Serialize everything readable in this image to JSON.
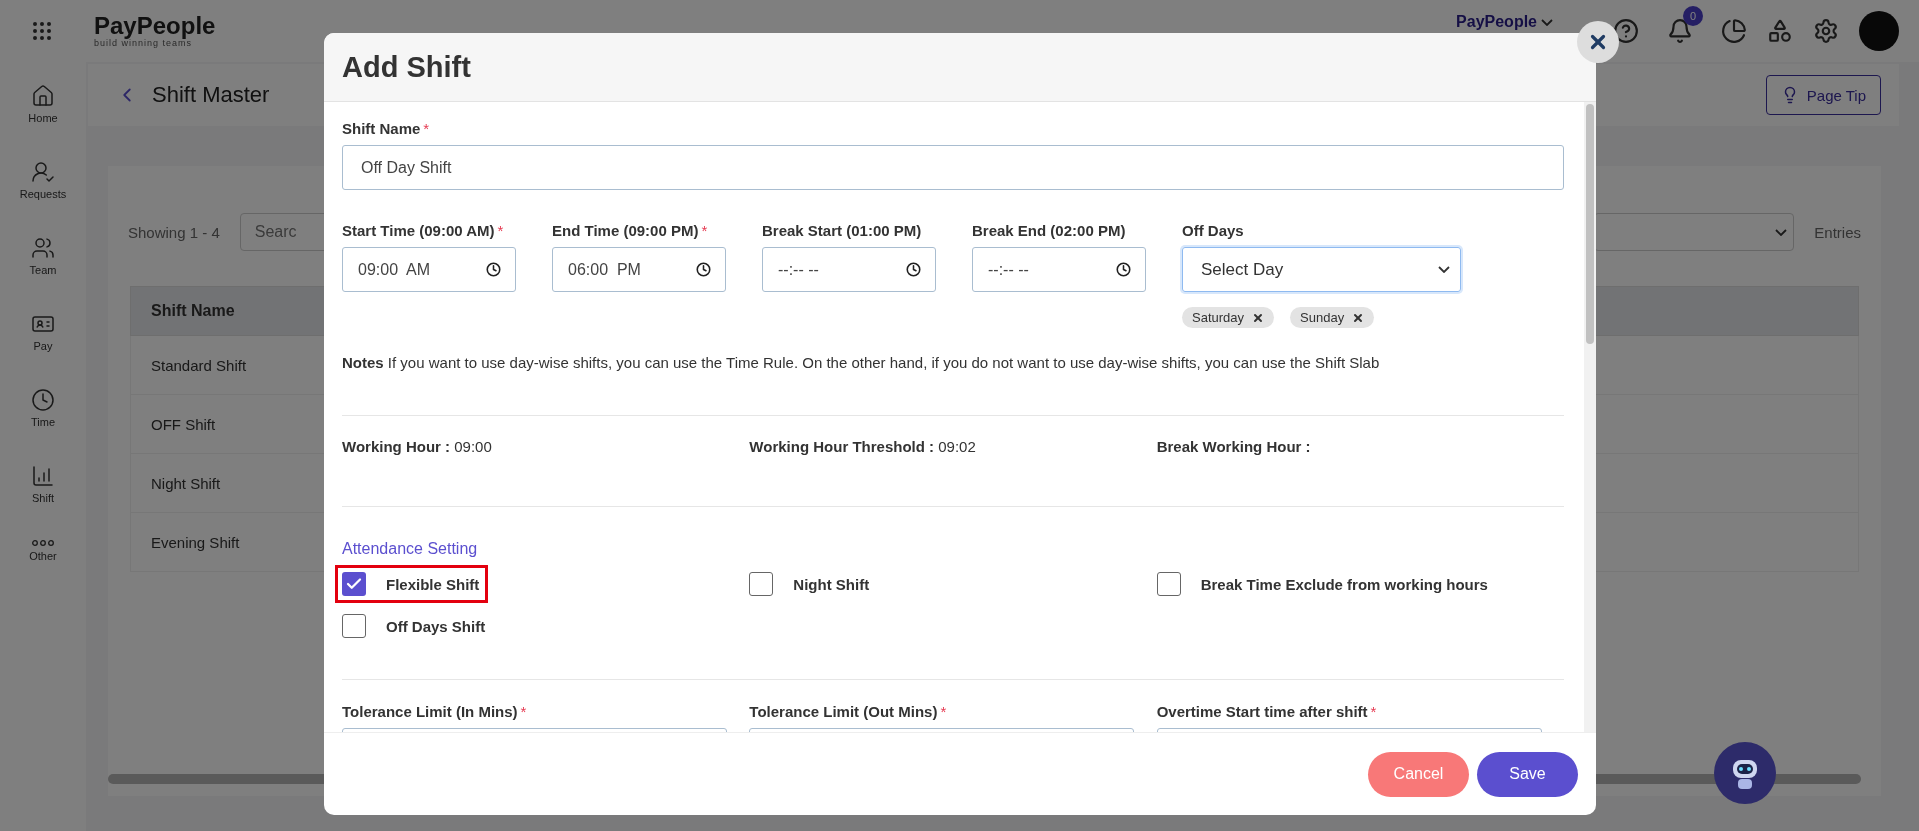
{
  "topbar": {
    "logo": "PayPeople",
    "tagline": "build winning teams",
    "org": "PayPeople",
    "notifications": "0"
  },
  "sidebar": [
    {
      "label": "Home",
      "kind": "home"
    },
    {
      "label": "Requests",
      "kind": "requests"
    },
    {
      "label": "Team",
      "kind": "team"
    },
    {
      "label": "Pay",
      "kind": "pay"
    },
    {
      "label": "Time",
      "kind": "time"
    },
    {
      "label": "Shift",
      "kind": "shift"
    },
    {
      "label": "Other",
      "kind": "other"
    }
  ],
  "page": {
    "title": "Shift Master",
    "page_tip": "Page Tip",
    "showing": "Showing 1 - 4",
    "search_placeholder": "Searc",
    "entries": "Entries",
    "table": {
      "columns": [
        "Shift Name"
      ],
      "rows": [
        [
          "Standard Shift"
        ],
        [
          "OFF Shift"
        ],
        [
          "Night Shift"
        ],
        [
          "Evening Shift"
        ]
      ]
    }
  },
  "modal": {
    "title": "Add Shift",
    "shift_name": {
      "label": "Shift Name",
      "required_mark": "*",
      "value": "Off Day Shift"
    },
    "time_fields": [
      {
        "label": "Start Time (09:00 AM)",
        "required_mark": "*",
        "value": "09:00  AM"
      },
      {
        "label": "End Time (09:00 PM)",
        "required_mark": "*",
        "value": "06:00  PM"
      },
      {
        "label": "Break Start (01:00 PM)",
        "value": "--:-- --"
      },
      {
        "label": "Break End (02:00 PM)",
        "value": "--:-- --"
      }
    ],
    "off_days": {
      "label": "Off Days",
      "placeholder": "Select Day",
      "tags": [
        "Saturday",
        "Sunday"
      ]
    },
    "notes": "**Notes** If you want to use day-wise shifts, you can use the Time Rule. On the other hand, if you do not want to use day-wise shifts, you can use the Shift Slab",
    "summary": [
      {
        "label": "Working Hour :",
        "value": "09:00"
      },
      {
        "label": "Working Hour Threshold :",
        "value": "09:02"
      },
      {
        "label": "Break Working Hour :"
      }
    ],
    "attendance": {
      "title": "Attendance Setting",
      "options": [
        {
          "label": "Flexible Shift",
          "checked": true,
          "highlighted": true
        },
        {
          "label": "Night Shift",
          "checked": false,
          "highlighted": false
        },
        {
          "label": "Break Time Exclude from working hours",
          "checked": false,
          "highlighted": false
        },
        {
          "label": "Off Days Shift",
          "checked": false,
          "highlighted": false
        }
      ]
    },
    "limits": [
      {
        "label": "Tolerance Limit (In Mins)",
        "required_mark": "*"
      },
      {
        "label": "Tolerance Limit (Out Mins)",
        "required_mark": "*"
      },
      {
        "label": "Overtime Start time after shift",
        "required_mark": "*"
      }
    ],
    "buttons": {
      "cancel": "Cancel",
      "save": "Save"
    }
  }
}
